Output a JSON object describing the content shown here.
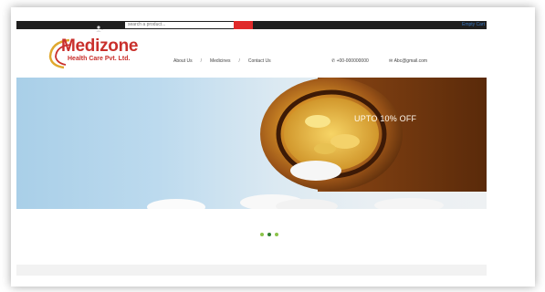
{
  "topbar": {
    "search_placeholder": "search a product...",
    "cart_label": "Empty Cart"
  },
  "logo": {
    "name": "Medizone",
    "tagline": "Health Care Pvt. Ltd."
  },
  "nav": {
    "items": [
      "About Us",
      "Medicines",
      "Contact Us"
    ],
    "separator": "/"
  },
  "contact": {
    "phone": "+00-000000000",
    "email": "Abc@gmail.com"
  },
  "hero": {
    "text": "UPTO 10% OFF"
  },
  "slider": {
    "dot_count": 3,
    "active_index": 1
  },
  "colors": {
    "brand_red": "#c9302c",
    "accent_red": "#e02a2a",
    "topbar": "#1f1f1f",
    "slider_dot_active": "#2e7d32",
    "slider_dot": "#8bc34a"
  }
}
